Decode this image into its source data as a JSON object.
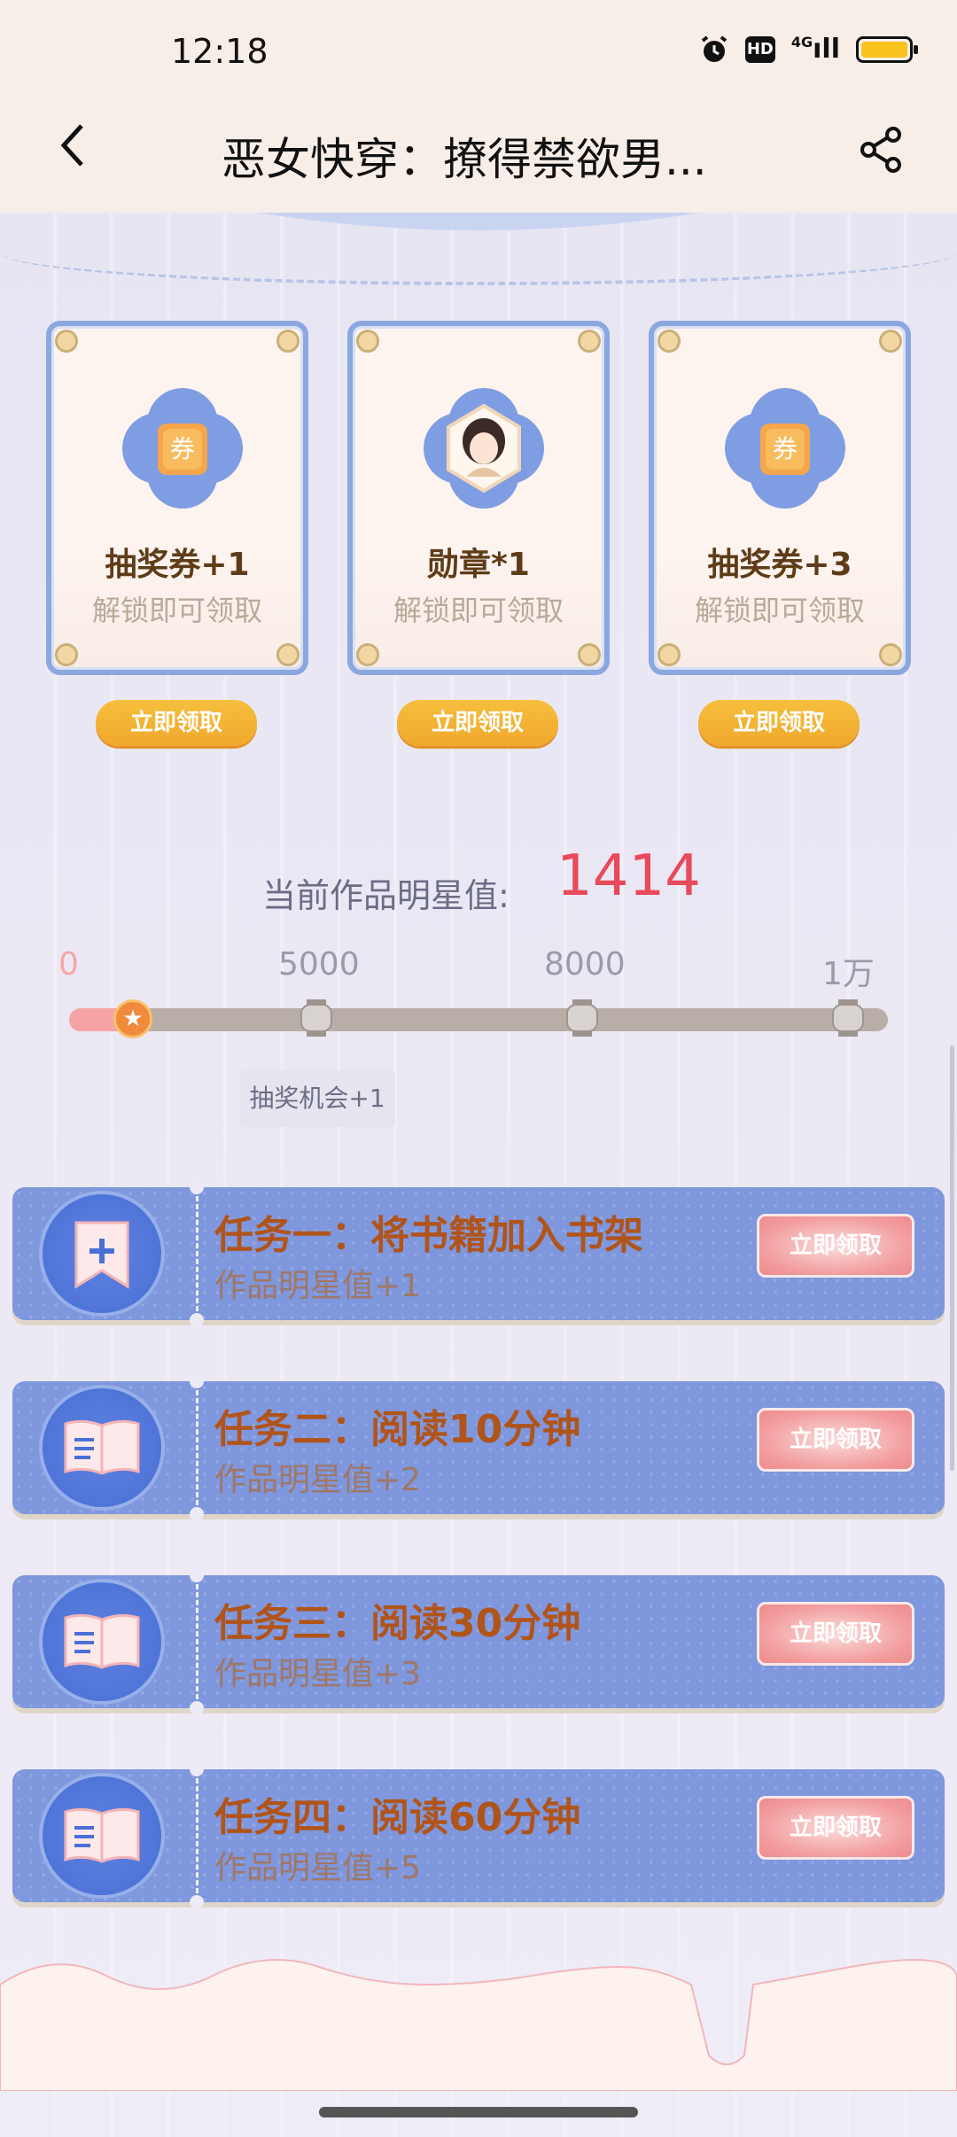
{
  "status_bar": {
    "time": "12:18",
    "network": "4G"
  },
  "header": {
    "title": "恶女快穿：撩得禁欲男..."
  },
  "rewards": [
    {
      "label": "抽奖券+1",
      "sub": "解锁即可领取",
      "icon": "ticket-icon",
      "button": "立即领取"
    },
    {
      "label": "勋章*1",
      "sub": "解锁即可领取",
      "icon": "medal-portrait-icon",
      "button": "立即领取"
    },
    {
      "label": "抽奖券+3",
      "sub": "解锁即可领取",
      "icon": "ticket-icon",
      "button": "立即领取"
    }
  ],
  "ticket_glyph": "券",
  "star": {
    "label": "当前作品明星值:",
    "value": "1414",
    "progress_fraction": 0.1414,
    "ticks": [
      "0",
      "5000",
      "8000",
      "1万"
    ],
    "tooltip": "抽奖机会+1"
  },
  "tasks": [
    {
      "title": "任务一：将书籍加入书架",
      "sub": "作品明星值+1",
      "icon": "bookmark-add-icon",
      "button": "立即领取"
    },
    {
      "title": "任务二：阅读10分钟",
      "sub": "作品明星值+2",
      "icon": "open-book-icon",
      "button": "立即领取"
    },
    {
      "title": "任务三：阅读30分钟",
      "sub": "作品明星值+3",
      "icon": "open-book-icon",
      "button": "立即领取"
    },
    {
      "title": "任务四：阅读60分钟",
      "sub": "作品明星值+5",
      "icon": "open-book-icon",
      "button": "立即领取"
    }
  ]
}
